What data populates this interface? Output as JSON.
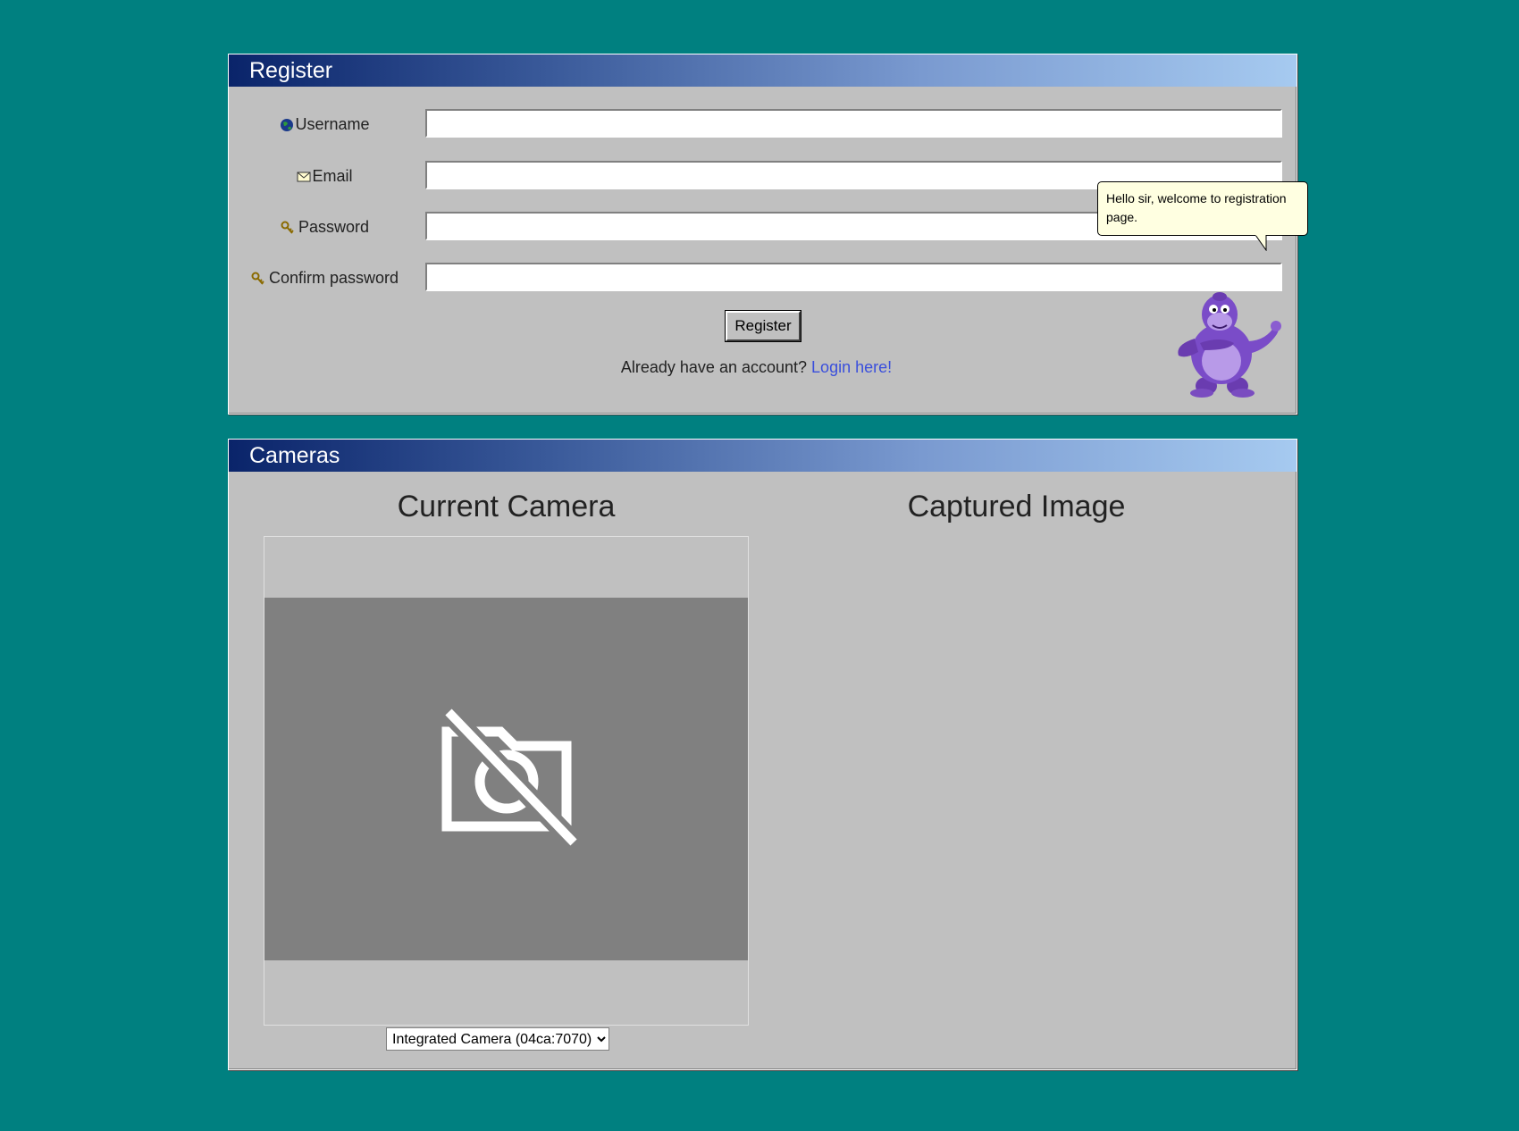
{
  "register": {
    "title": "Register",
    "fields": [
      {
        "label": "Username",
        "icon": "globe-icon",
        "value": "",
        "placeholder": ""
      },
      {
        "label": "Email",
        "icon": "envelope-icon",
        "value": "",
        "placeholder": ""
      },
      {
        "label": "Password",
        "icon": "key-icon",
        "value": "",
        "placeholder": ""
      },
      {
        "label": "Confirm password",
        "icon": "key-icon",
        "value": "",
        "placeholder": ""
      }
    ],
    "button_label": "Register",
    "login_prompt": "Already have an account?",
    "login_link": "Login here!"
  },
  "assistant": {
    "message": "Hello sir, welcome to registration page.",
    "character": "purple-gorilla-mascot"
  },
  "cameras": {
    "title": "Cameras",
    "current_heading": "Current Camera",
    "captured_heading": "Captured Image",
    "no_camera_icon": "camera-off-icon",
    "selected_camera": "Integrated Camera (04ca:7070)"
  },
  "colors": {
    "desktop": "#008080",
    "window": "#c0c0c0",
    "title_start": "#0a246a",
    "title_end": "#a6caf0",
    "link": "#3a4fdc",
    "balloon": "#ffffe1",
    "mascot": "#8a5cd0"
  }
}
